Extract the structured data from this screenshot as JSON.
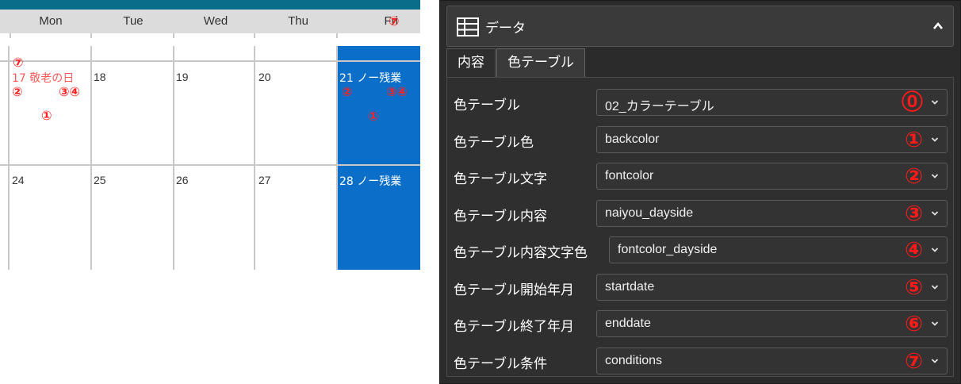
{
  "calendar": {
    "weekdays": [
      "Mon",
      "Tue",
      "Wed",
      "Thu",
      "Fri"
    ],
    "fri_marker": "⑦",
    "week1": [
      {
        "day": "17 敬老の日",
        "style": "red"
      },
      {
        "day": "18",
        "style": "normal"
      },
      {
        "day": "19",
        "style": "normal"
      },
      {
        "day": "20",
        "style": "normal"
      },
      {
        "day": "21 ノー残業",
        "style": "white"
      }
    ],
    "week2": [
      {
        "day": "24",
        "style": "normal"
      },
      {
        "day": "25",
        "style": "normal"
      },
      {
        "day": "26",
        "style": "normal"
      },
      {
        "day": "27",
        "style": "normal"
      },
      {
        "day": "28 ノー残業",
        "style": "white"
      }
    ],
    "markers": {
      "mon_top": "⑦",
      "mon_left": "②",
      "mon_right": "③④",
      "mon_center": "①",
      "fri_left": "②",
      "fri_right": "③④",
      "fri_center": "①"
    },
    "colors": {
      "header_bar": "#0a6e8a",
      "highlight": "#0b6fc9",
      "holiday_text": "#ff5a5a",
      "marker": "#ff2020"
    }
  },
  "panel": {
    "header": {
      "title": "データ",
      "icon": "grid-icon",
      "collapse_icon": "chevron-up-icon"
    },
    "tabs": [
      {
        "label": "内容",
        "active": false
      },
      {
        "label": "色テーブル",
        "active": true
      }
    ],
    "rows": [
      {
        "label": "色テーブル",
        "value": "02_カラーテーブル",
        "marker": "⓪"
      },
      {
        "label": "色テーブル色",
        "value": "backcolor",
        "marker": "①"
      },
      {
        "label": "色テーブル文字",
        "value": "fontcolor",
        "marker": "②"
      },
      {
        "label": "色テーブル内容",
        "value": "naiyou_dayside",
        "marker": "③"
      },
      {
        "label": "色テーブル内容文字色",
        "value": "fontcolor_dayside",
        "marker": "④"
      },
      {
        "label": "色テーブル開始年月",
        "value": "startdate",
        "marker": "⑤"
      },
      {
        "label": "色テーブル終了年月",
        "value": "enddate",
        "marker": "⑥"
      },
      {
        "label": "色テーブル条件",
        "value": "conditions",
        "marker": "⑦"
      }
    ],
    "colors": {
      "bg": "#2b2b2b",
      "marker": "#ff1a1a"
    }
  }
}
